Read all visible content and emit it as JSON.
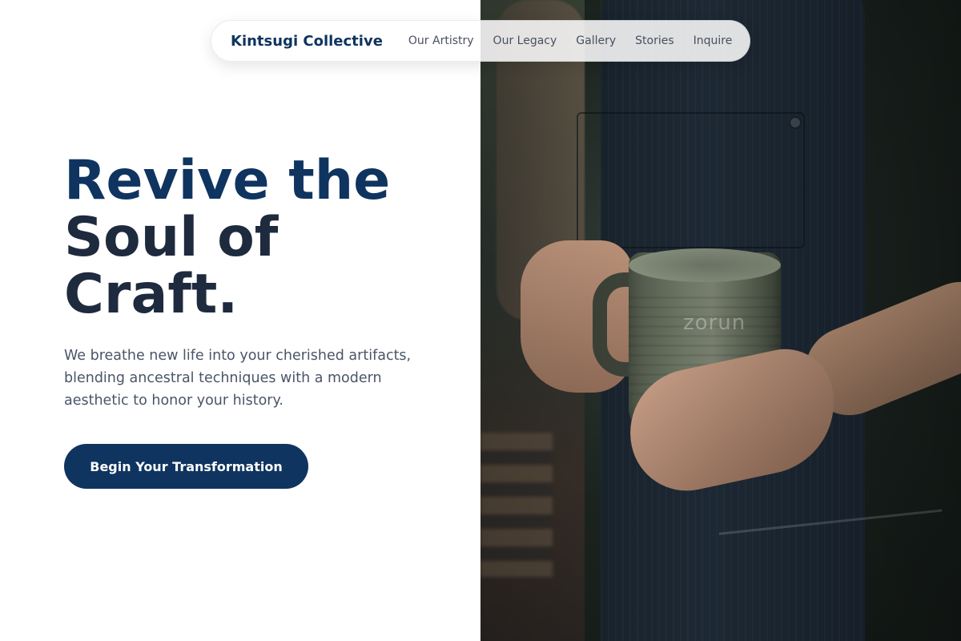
{
  "nav": {
    "brand": "Kintsugi Collective",
    "links": [
      "Our Artistry",
      "Our Legacy",
      "Gallery",
      "Stories",
      "Inquire"
    ]
  },
  "hero": {
    "headline_line1": "Revive the",
    "headline_line2": "Soul of",
    "headline_line3": "Craft.",
    "subtext": "We breathe new life into your cherished artifacts, blending ancestral techniques with a modern aesthetic to honor your history.",
    "cta_label": "Begin Your Transformation"
  },
  "image": {
    "watermark": "zorun"
  },
  "colors": {
    "brand_navy": "#0f3460",
    "headline_dark": "#1e2a3e",
    "body_text": "#4a5568",
    "background": "#ffffff"
  }
}
